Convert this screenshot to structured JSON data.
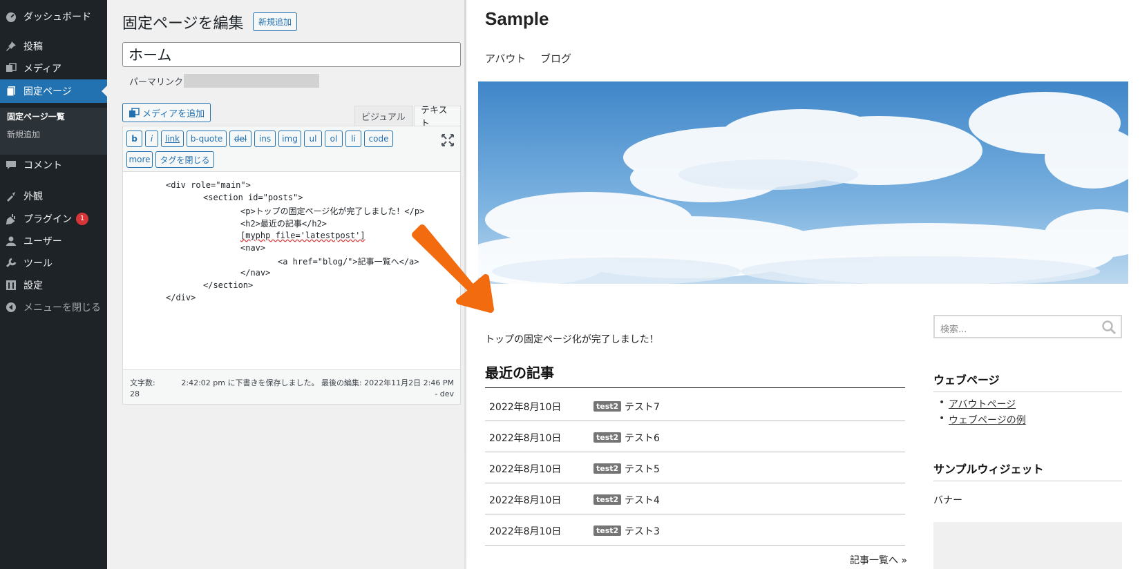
{
  "admin_menu": {
    "items": [
      {
        "label": "ダッシュボード",
        "icon": "dashboard-icon"
      },
      {
        "label": "投稿",
        "icon": "pin-icon"
      },
      {
        "label": "メディア",
        "icon": "media-icon"
      },
      {
        "label": "固定ページ",
        "icon": "pages-icon"
      },
      {
        "label": "コメント",
        "icon": "comment-icon"
      },
      {
        "label": "外観",
        "icon": "appearance-icon"
      },
      {
        "label": "プラグイン",
        "icon": "plugin-icon",
        "badge": "1"
      },
      {
        "label": "ユーザー",
        "icon": "user-icon"
      },
      {
        "label": "ツール",
        "icon": "wrench-icon"
      },
      {
        "label": "設定",
        "icon": "settings-icon"
      },
      {
        "label": "メニューを閉じる",
        "icon": "collapse-icon"
      }
    ],
    "submenu": [
      "固定ページ一覧",
      "新規追加"
    ]
  },
  "editor": {
    "heading": "固定ページを編集",
    "add_new": "新規追加",
    "title_value": "ホーム",
    "permalink_label": "パーマリンク:",
    "add_media": "メディアを追加",
    "tab_visual": "ビジュアル",
    "tab_text": "テキスト",
    "quicktags": [
      "b",
      "i",
      "link",
      "b-quote",
      "del",
      "ins",
      "img",
      "ul",
      "ol",
      "li",
      "code",
      "more",
      "タグを閉じる"
    ],
    "code_lines": [
      "<div role=\"main\">",
      "<section id=\"posts\">",
      "<p>トップの固定ページ化が完了しました！</p>",
      "<h2>最近の記事</h2>",
      "[myphp file='latestpost']",
      "<nav>",
      "<a href=\"blog/\">記事一覧へ</a>",
      "</nav>",
      "</section>",
      "</div>"
    ],
    "wordcount_label": "文字数:",
    "wordcount_value": "28",
    "autosave_text": "2:42:02 pm に下書きを保存しました。 最後の編集: 2022年11月2日 2:46 PM",
    "autosave_user": "- dev"
  },
  "site": {
    "title": "Sample",
    "nav": [
      "アバウト",
      "ブログ"
    ],
    "intro": "トップの固定ページ化が完了しました！",
    "posts_heading": "最近の記事",
    "posts": [
      {
        "date": "2022年8月10日",
        "category": "test2",
        "title": "テスト7"
      },
      {
        "date": "2022年8月10日",
        "category": "test2",
        "title": "テスト6"
      },
      {
        "date": "2022年8月10日",
        "category": "test2",
        "title": "テスト5"
      },
      {
        "date": "2022年8月10日",
        "category": "test2",
        "title": "テスト4"
      },
      {
        "date": "2022年8月10日",
        "category": "test2",
        "title": "テスト3"
      }
    ],
    "more_link": "記事一覧へ »",
    "search_placeholder": "検索...",
    "widget_webpages_title": "ウェブページ",
    "widget_webpages_links": [
      "アバウトページ",
      "ウェブページの例"
    ],
    "widget_sample_title": "サンプルウィジェット",
    "banner_label": "バナー"
  },
  "colors": {
    "admin_bg": "#1d2327",
    "admin_accent": "#2271b1",
    "arrow": "#f26b0f",
    "badge": "#d63638"
  }
}
